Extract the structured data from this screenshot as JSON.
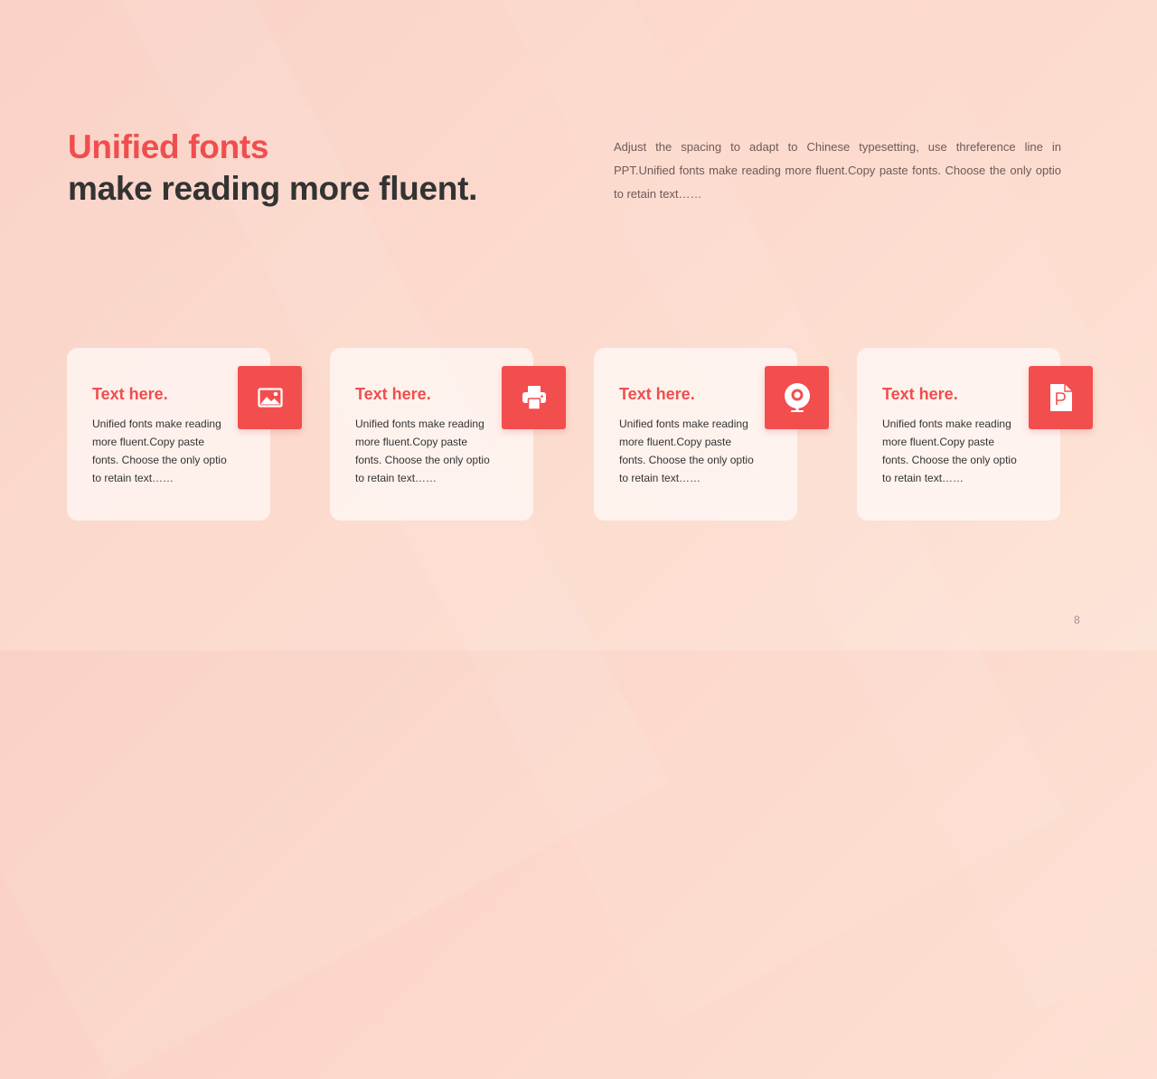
{
  "title": {
    "line1": "Unified fonts",
    "line2": "make reading more fluent."
  },
  "description": "Adjust the spacing to adapt to Chinese typesetting, use threference line in PPT.Unified fonts make reading more fluent.Copy paste fonts. Choose the only optio to retain text……",
  "cards": [
    {
      "title": "Text here.",
      "text": "Unified fonts make reading more fluent.Copy paste fonts. Choose the only optio to retain text……",
      "icon": "image-icon"
    },
    {
      "title": "Text here.",
      "text": "Unified fonts make reading more fluent.Copy paste fonts. Choose the only optio to retain text……",
      "icon": "printer-icon"
    },
    {
      "title": "Text here.",
      "text": "Unified fonts make reading more fluent.Copy paste fonts. Choose the only optio to retain text……",
      "icon": "webcam-icon"
    },
    {
      "title": "Text here.",
      "text": "Unified fonts make reading more fluent.Copy paste fonts. Choose the only optio to retain text……",
      "icon": "ppt-file-icon"
    }
  ],
  "page_number": "8",
  "colors": {
    "accent": "#f24e4e",
    "heading_dark": "#333333",
    "body_text": "#6e5a58"
  }
}
